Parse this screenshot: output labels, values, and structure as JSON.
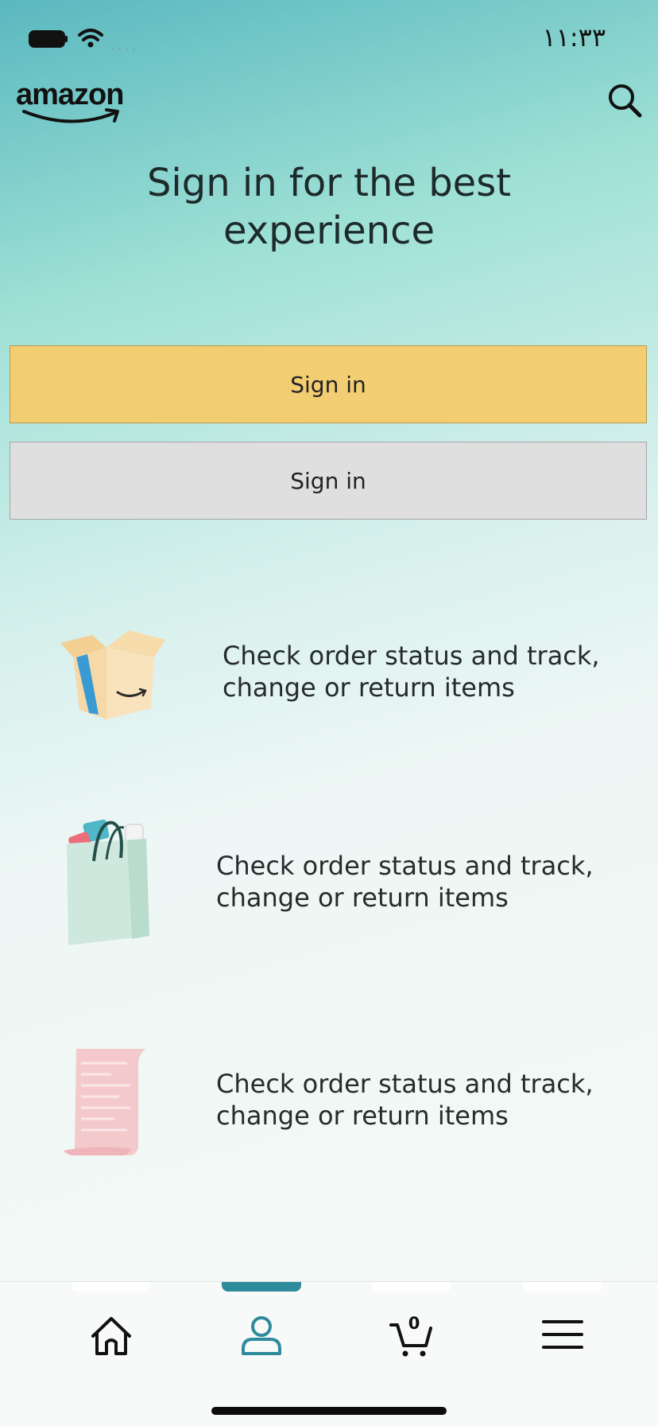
{
  "status_bar": {
    "signal_dots": "....",
    "time": "١١:٣٣"
  },
  "header": {
    "logo_text": "amazon",
    "search_icon": "search-icon"
  },
  "title": {
    "line1": "Sign in for the best",
    "line2": "experience"
  },
  "buttons": {
    "primary_label": "Sign in",
    "secondary_label": "Sign in"
  },
  "features": [
    {
      "icon": "box-icon",
      "text_line1": "Check order status and track,",
      "text_line2": "change or return items"
    },
    {
      "icon": "shopping-bag-icon",
      "text_line1": "Check order status and track,",
      "text_line2": "change or return items"
    },
    {
      "icon": "receipt-icon",
      "text_line1": "Check order status and track,",
      "text_line2": "change or return items"
    }
  ],
  "tab_bar": {
    "tabs": [
      {
        "icon": "home-icon",
        "active": false
      },
      {
        "icon": "account-icon",
        "active": true
      },
      {
        "icon": "cart-icon",
        "active": false,
        "badge": "0"
      },
      {
        "icon": "menu-icon",
        "active": false
      }
    ]
  },
  "colors": {
    "accent": "#2e8b9c",
    "primary_button": "#f3cd72",
    "secondary_button": "#dfdfe0"
  }
}
